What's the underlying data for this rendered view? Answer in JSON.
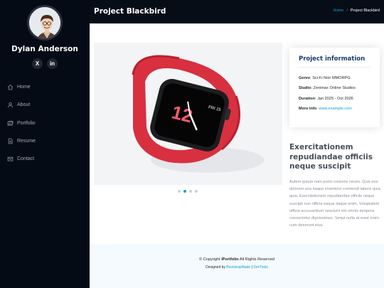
{
  "profile": {
    "name": "Dylan Anderson"
  },
  "socials": [
    {
      "icon": "x-icon",
      "glyph": "X"
    },
    {
      "icon": "linkedin-icon",
      "glyph": "in"
    }
  ],
  "nav": [
    {
      "label": "Home",
      "icon": "home-icon"
    },
    {
      "label": "About",
      "icon": "person-icon"
    },
    {
      "label": "Portfolio",
      "icon": "images-icon"
    },
    {
      "label": "Resume",
      "icon": "file-icon"
    },
    {
      "label": "Contact",
      "icon": "envelope-icon"
    }
  ],
  "header": {
    "title": "Project Blackbird",
    "breadcrumb": {
      "home": "Home",
      "separator": "/",
      "current": "Project Blackbird"
    }
  },
  "slider": {
    "active_index": 1,
    "dot_count": 4
  },
  "project_info": {
    "title": "Project information",
    "items": [
      {
        "label": "Genre",
        "value": "Sci-Fi Noir MMORPG"
      },
      {
        "label": "Studio",
        "value": "Zenimax Online Studios"
      },
      {
        "label": "Duration",
        "value": "Jan 2025 - Oct 2026"
      },
      {
        "label": "More Info",
        "value": "www.example.com"
      }
    ]
  },
  "description": {
    "title": "Exercitationem repudiandae officiis neque suscipit",
    "body": "Autem ipsum nam porro corporis rerum. Quis eos dolorem eos itaque inventore commodi labore quia quia. Exercitationem repudiandae officiis neque suscipit non officia eaque itaque enim. Voluptatem officia accusantium nesciunt est omnis tempora consectetur dignissimos. Sequi nulla at esse enim cum deserunt eius."
  },
  "footer": {
    "copyright_prefix": "© Copyright",
    "brand": "iPortfolio",
    "rights": "All Rights Reserved",
    "designed_by": "Designed by",
    "designer": "BootstrapMade",
    "separator": "|",
    "devtools": "DevTools"
  },
  "colors": {
    "accent": "#149ddd",
    "sidebar": "#040b14",
    "heading": "#173b6c"
  }
}
